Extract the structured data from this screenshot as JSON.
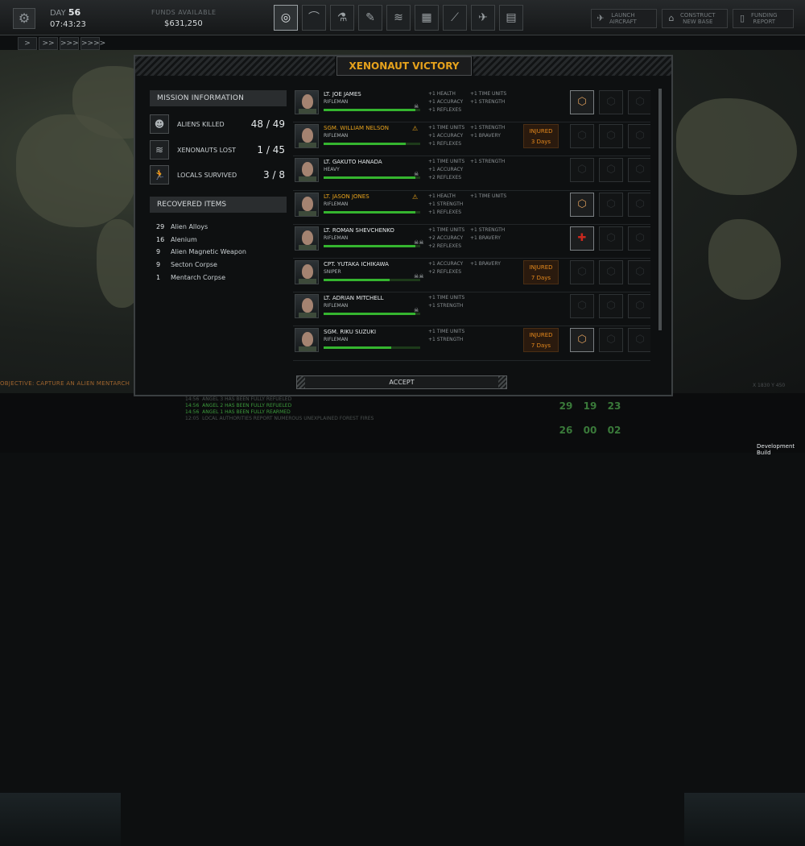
{
  "topbar": {
    "day_label": "DAY",
    "day": "56",
    "time": "07:43:23",
    "funds_label": "FUNDS AVAILABLE",
    "funds": "$631,250"
  },
  "nav_icons": [
    "globe-icon",
    "hangar-icon",
    "research-icon",
    "engineering-icon",
    "rank-icon",
    "base-icon",
    "rifle-icon",
    "jet-icon",
    "stats-icon"
  ],
  "right_buttons": [
    {
      "l1": "LAUNCH",
      "l2": "AIRCRAFT",
      "icon": "plane-icon"
    },
    {
      "l1": "CONSTRUCT",
      "l2": "NEW BASE",
      "icon": "base-build-icon"
    },
    {
      "l1": "FUNDING",
      "l2": "REPORT",
      "icon": "phone-icon"
    }
  ],
  "speed_buttons": [
    ">",
    ">>",
    ">>>",
    ">>>>"
  ],
  "objective": "OBJECTIVE: CAPTURE AN ALIEN MENTARCH",
  "coords": "X 1830 Y 450",
  "modal": {
    "title": "XENONAUT VICTORY",
    "mission_head": "MISSION INFORMATION",
    "stats": [
      {
        "label": "ALIENS KILLED",
        "value": "48 / 49",
        "icon": "alien-head-icon"
      },
      {
        "label": "XENONAUTS LOST",
        "value": "1 / 45",
        "icon": "chevron-rank-icon"
      },
      {
        "label": "LOCALS SURVIVED",
        "value": "3 / 8",
        "icon": "running-man-icon"
      }
    ],
    "recovered_head": "RECOVERED ITEMS",
    "items": [
      {
        "qty": "29",
        "name": "Alien Alloys"
      },
      {
        "qty": "16",
        "name": "Alenium"
      },
      {
        "qty": "9",
        "name": "Alien Magnetic Weapon"
      },
      {
        "qty": "9",
        "name": "Secton Corpse"
      },
      {
        "qty": "1",
        "name": "Mentarch Corpse"
      }
    ],
    "accept": "ACCEPT"
  },
  "soldiers": [
    {
      "name": "LT. JOE JAMES",
      "role": "RIFLEMAN",
      "xp": 0.95,
      "kills": "1",
      "gold": false,
      "g1": [
        "+1 HEALTH",
        "+1 ACCURACY",
        "+1 REFLEXES"
      ],
      "g2": [
        "+1 TIME UNITS",
        "+1 STRENGTH"
      ],
      "injury": null,
      "medals": [
        "on",
        "",
        ""
      ]
    },
    {
      "name": "SGM. WILLIAM NELSON",
      "role": "RIFLEMAN",
      "xp": 0.85,
      "kills": "",
      "gold": true,
      "g1": [
        "+1 TIME UNITS",
        "+1 ACCURACY",
        "+1 REFLEXES"
      ],
      "g2": [
        "",
        "+1 STRENGTH",
        "+1 BRAVERY"
      ],
      "injury": {
        "l1": "INJURED",
        "l2": "3 Days"
      },
      "medals": [
        "",
        "",
        ""
      ]
    },
    {
      "name": "LT. GAKUTO HANADA",
      "role": "HEAVY",
      "xp": 0.95,
      "kills": "1",
      "gold": false,
      "g1": [
        "+1 TIME UNITS",
        "+1 ACCURACY",
        "+2 REFLEXES"
      ],
      "g2": [
        "",
        "+1 STRENGTH",
        ""
      ],
      "injury": null,
      "medals": [
        "",
        "",
        ""
      ]
    },
    {
      "name": "LT. JASON JONES",
      "role": "RIFLEMAN",
      "xp": 0.95,
      "kills": "",
      "gold": true,
      "g1": [
        "+1 HEALTH",
        "+1 STRENGTH",
        "+1 REFLEXES"
      ],
      "g2": [
        "+1 TIME UNITS",
        "",
        ""
      ],
      "injury": null,
      "medals": [
        "on",
        "",
        ""
      ]
    },
    {
      "name": "LT. ROMAN SHEVCHENKO",
      "role": "RIFLEMAN",
      "xp": 0.95,
      "kills": "2",
      "gold": false,
      "g1": [
        "+1 TIME UNITS",
        "+2 ACCURACY",
        "+2 REFLEXES"
      ],
      "g2": [
        "",
        "+1 STRENGTH",
        "+1 BRAVERY"
      ],
      "injury": null,
      "medals": [
        "red",
        "",
        ""
      ]
    },
    {
      "name": "CPT. YUTAKA ICHIKAWA",
      "role": "SNIPER",
      "xp": 0.68,
      "kills": "2",
      "gold": false,
      "g1": [
        "",
        "+1 ACCURACY",
        "+2 REFLEXES"
      ],
      "g2": [
        "",
        "",
        "+1 BRAVERY"
      ],
      "injury": {
        "l1": "INJURED",
        "l2": "7 Days"
      },
      "medals": [
        "",
        "",
        ""
      ]
    },
    {
      "name": "LT. ADRIAN MITCHELL",
      "role": "RIFLEMAN",
      "xp": 0.95,
      "kills": "1",
      "gold": false,
      "g1": [
        "+1 TIME UNITS",
        "+1 STRENGTH",
        ""
      ],
      "g2": [
        "",
        "",
        ""
      ],
      "injury": null,
      "medals": [
        "",
        "",
        ""
      ]
    },
    {
      "name": "SGM. RIKU SUZUKI",
      "role": "RIFLEMAN",
      "xp": 0.7,
      "kills": "",
      "gold": false,
      "g1": [
        "+1 TIME UNITS",
        "+1 STRENGTH",
        ""
      ],
      "g2": [
        "",
        "",
        ""
      ],
      "injury": {
        "l1": "INJURED",
        "l2": "7 Days"
      },
      "medals": [
        "on",
        "",
        ""
      ]
    }
  ],
  "log": [
    {
      "t": "14:56",
      "m": "ANGEL 3 HAS BEEN FULLY REFUELED",
      "c": "d"
    },
    {
      "t": "14:56",
      "m": "ANGEL 2 HAS BEEN FULLY REFUELED",
      "c": "g"
    },
    {
      "t": "14:56",
      "m": "ANGEL 1 HAS BEEN FULLY REARMED",
      "c": "g"
    },
    {
      "t": "12:05",
      "m": "LOCAL AUTHORITIES REPORT NUMEROUS UNEXPLAINED FOREST FIRES",
      "c": "d"
    }
  ],
  "counters": [
    "29",
    "19",
    "23",
    "26",
    "00",
    "02"
  ],
  "dev_build": "Development Build"
}
